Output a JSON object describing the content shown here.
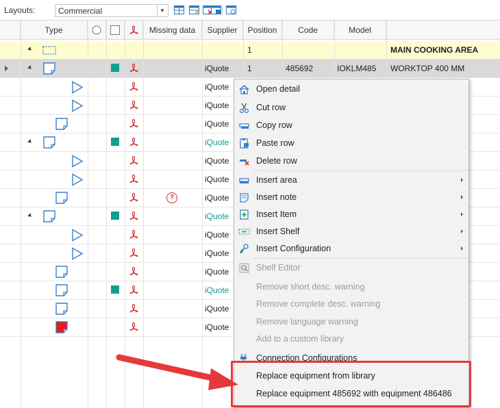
{
  "toolbar": {
    "layouts_label": "Layouts:",
    "layout_value": "Commercial",
    "icons": [
      "layout-grid-icon",
      "layout-edit-icon",
      "layout-delete-icon",
      "layout-save-icon",
      "layout-options-icon"
    ]
  },
  "columns": {
    "type": "Type",
    "circle": "",
    "checkbox": "",
    "pdf": "",
    "missing_data": "Missing data",
    "supplier": "Supplier",
    "position": "Position",
    "code": "Code",
    "model": "Model",
    "description": ""
  },
  "rows": [
    {
      "kind": "area",
      "position": "1",
      "description": "MAIN COOKING AREA"
    },
    {
      "kind": "note",
      "supplier": "iQuote",
      "position": "1",
      "code": "485692",
      "model": "IOKLM485",
      "description": "WORKTOP 400 MM"
    },
    {
      "kind": "item",
      "supplier": "iQuote",
      "description": "M"
    },
    {
      "kind": "item",
      "supplier": "iQuote",
      "description": "ASE C"
    },
    {
      "kind": "note",
      "supplier": "iQuote",
      "description": "R 1X40"
    },
    {
      "kind": "note",
      "supplier": "iQuote",
      "description": ""
    },
    {
      "kind": "item",
      "supplier": "iQuote",
      "description": "ASE C"
    },
    {
      "kind": "item",
      "supplier": "iQuote",
      "description": "MM"
    },
    {
      "kind": "note",
      "supplier": "iQuote",
      "description": "ILING"
    },
    {
      "kind": "note",
      "supplier": "iQuote",
      "description": ""
    },
    {
      "kind": "item",
      "supplier": "iQuote",
      "description": "ASE C"
    },
    {
      "kind": "item",
      "supplier": "iQuote",
      "description": "MM"
    },
    {
      "kind": "note",
      "supplier": "iQuote",
      "description": "ILING"
    },
    {
      "kind": "note",
      "supplier": "iQuote",
      "description": ""
    },
    {
      "kind": "note",
      "supplier": "iQuote",
      "description": "WELL"
    },
    {
      "kind": "note",
      "supplier": "iQuote",
      "description": "SHELF"
    }
  ],
  "context_menu": {
    "open_detail": "Open detail",
    "cut_row": "Cut row",
    "copy_row": "Copy row",
    "paste_row": "Paste row",
    "delete_row": "Delete row",
    "insert_area": "Insert area",
    "insert_note": "Insert note",
    "insert_item": "Insert Item",
    "insert_shelf": "Insert Shelf",
    "insert_configuration": "Insert Configuration",
    "shelf_editor": "Shelf Editor",
    "remove_short_desc": "Remove short desc. warning",
    "remove_complete_desc": "Remove complete desc. warning",
    "remove_language": "Remove language warning",
    "add_custom_library": "Add to a custom library",
    "connection_configurations": "Connection Configurations",
    "replace_from_library": "Replace equipment from library",
    "replace_specific": "Replace equipment 485692 with equipment 486486"
  },
  "colors": {
    "accent_teal": "#139f90",
    "annotation_red": "#e5393a",
    "area_yellow": "#fdfdcf",
    "selected_gray": "#d9d9d9"
  }
}
